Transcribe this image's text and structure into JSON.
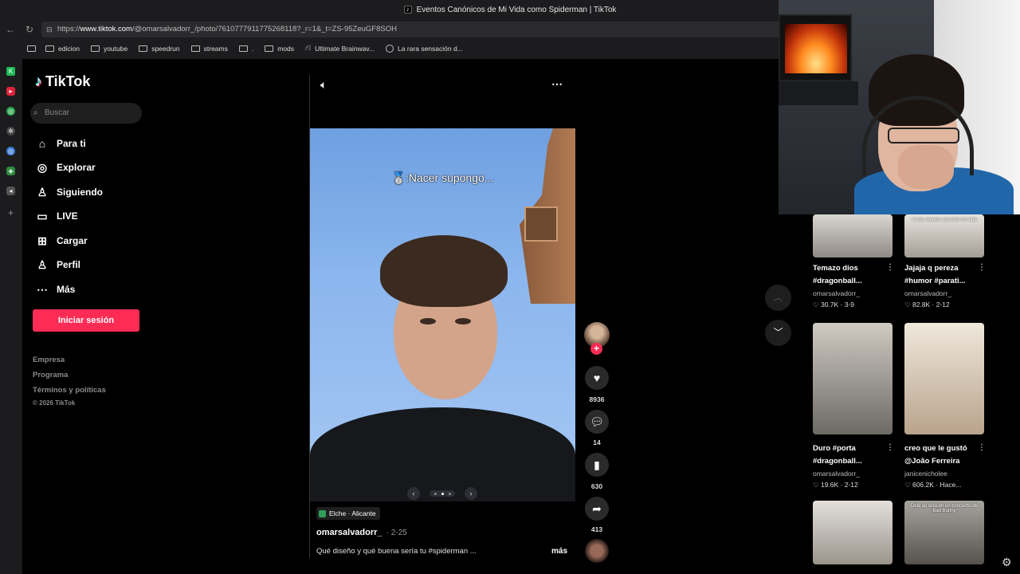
{
  "browser": {
    "window_title": "Eventos Canónicos de Mi Vida como Spiderman | TikTok",
    "url_prefix": "https://",
    "url_domain": "www.tiktok.com",
    "url_rest": "/@omarsalvadorr_/photo/7610777911775268118?_r=1&_t=ZS-95ZeuGF8SOH",
    "bookmarks": [
      {
        "label": "edicion",
        "icon": "folder-icon"
      },
      {
        "label": "youtube",
        "icon": "folder-icon"
      },
      {
        "label": "speedrun",
        "icon": "folder-icon"
      },
      {
        "label": "streams",
        "icon": "folder-icon"
      },
      {
        "label": ".",
        "icon": "folder-icon"
      },
      {
        "label": "mods",
        "icon": "folder-icon"
      },
      {
        "label": "Ultimate Brainwav...",
        "icon": "road-icon"
      },
      {
        "label": "La rara sensación d...",
        "icon": "globe-icon"
      }
    ]
  },
  "sidebar": {
    "logo": "TikTok",
    "search_placeholder": "Buscar",
    "nav": [
      {
        "label": "Para ti",
        "icon": "home-icon"
      },
      {
        "label": "Explorar",
        "icon": "compass-icon"
      },
      {
        "label": "Siguiendo",
        "icon": "following-icon"
      },
      {
        "label": "LIVE",
        "icon": "live-icon"
      },
      {
        "label": "Cargar",
        "icon": "upload-icon"
      },
      {
        "label": "Perfil",
        "icon": "profile-icon"
      },
      {
        "label": "Más",
        "icon": "more-dots-icon"
      }
    ],
    "login_button": "Iniciar sesión",
    "footer": [
      "Empresa",
      "Programa",
      "Términos y políticas"
    ],
    "copyright": "© 2026 TikTok"
  },
  "post": {
    "photo_caption": "🥈:Nacer supongo...",
    "location": "Elche · Alicante",
    "author": "omarsalvadorr_",
    "date": "· 2-25",
    "description": "Qué diseño y qué buena sería tu #spiderman ...",
    "more_label": "más",
    "likes": "8936",
    "comments": "14",
    "saves": "630",
    "shares": "413",
    "carousel_index": 2,
    "carousel_total": 3
  },
  "related": [
    {
      "title": "Temazo dios",
      "tags": "#dragonball...",
      "author": "omarsalvadorr_",
      "stats": "♡ 30.7K · 3-9",
      "colors": [
        "#d9d6d0",
        "#8f8a84"
      ]
    },
    {
      "title": "Jajaja q pereza",
      "tags": "#humor #parati...",
      "author": "omarsalvadorr_",
      "stats": "♡ 82.8K · 2-12",
      "colors": [
        "#e8e4de",
        "#a39d95"
      ]
    },
    {
      "title": "Duro #porta",
      "tags": "#dragonball...",
      "author": "omarsalvadorr_",
      "stats": "♡ 19.6K · 2-12",
      "colors": [
        "#cfcac2",
        "#6d6a66"
      ]
    },
    {
      "title": "creo que le gustó",
      "tags": "@João Ferreira",
      "author": "janicenicholee",
      "stats": "♡ 606.2K · Hace...",
      "colors": [
        "#efe8dc",
        "#b9a38c"
      ]
    },
    {
      "title": "",
      "tags": "",
      "author": "",
      "stats": "",
      "colors": [
        "#e3e0db",
        "#9a948c"
      ]
    },
    {
      "title": "",
      "tags": "",
      "author": "",
      "stats": "",
      "colors": [
        "#a7a49f",
        "#55524f"
      ]
    }
  ],
  "thumb_overlays": [
    "",
    "si mis nuevos conocen mi vida",
    "",
    "",
    "",
    "Dele su vida en un concierto de Bad Bunny"
  ],
  "colors": {
    "accent": "#fe2c55",
    "background": "#000000"
  }
}
